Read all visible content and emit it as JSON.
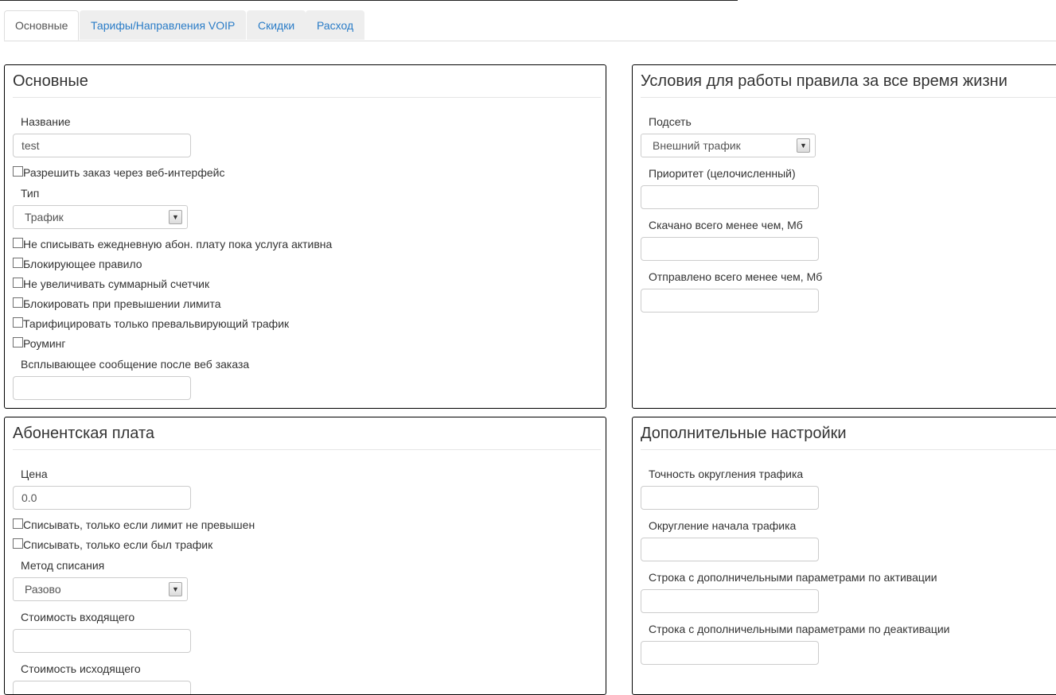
{
  "tabs": [
    {
      "label": "Основные"
    },
    {
      "label": "Тарифы/Направления VOIP"
    },
    {
      "label": "Скидки"
    },
    {
      "label": "Расход"
    }
  ],
  "basic": {
    "title": "Основные",
    "name_label": "Название",
    "name_value": "test",
    "allow_web_order": "Разрешить заказ через веб-интерфейс",
    "type_label": "Тип",
    "type_value": "Трафик",
    "checkboxes": [
      "Не списывать ежедневную абон. плату пока услуга активна",
      "Блокирующее правило",
      "Не увеличивать суммарный счетчик",
      "Блокировать при превышении лимита",
      "Тарифицировать только превальвирующий трафик",
      "Роуминг"
    ],
    "popup_label": "Всплывающее сообщение после веб заказа",
    "popup_value": ""
  },
  "lifetime": {
    "title": "Условия для работы правила за все время жизни",
    "subnet_label": "Подсеть",
    "subnet_value": "Внешний трафик",
    "priority_label": "Приоритет (целочисленный)",
    "downloaded_label": "Скачано всего менее чем, Мб",
    "uploaded_label": "Отправлено всего менее чем, Мб"
  },
  "fee": {
    "title": "Абонентская плата",
    "price_label": "Цена",
    "price_value": "0.0",
    "checkboxes": [
      "Списывать, только если лимит не превышен",
      "Списывать, только если был трафик"
    ],
    "method_label": "Метод списания",
    "method_value": "Разово",
    "incoming_label": "Стоимость входящего",
    "outgoing_label": "Стоимость исходящего"
  },
  "extra": {
    "title": "Дополнительные настройки",
    "rounding_label": "Точность округления трафика",
    "start_rounding_label": "Округление начала трафика",
    "activation_label": "Строка с дополничельными параметрами по активации",
    "deactivation_label": "Строка с дополничельными параметрами по деактивации"
  },
  "icons": {
    "dropdown": "chevron-down-icon"
  }
}
